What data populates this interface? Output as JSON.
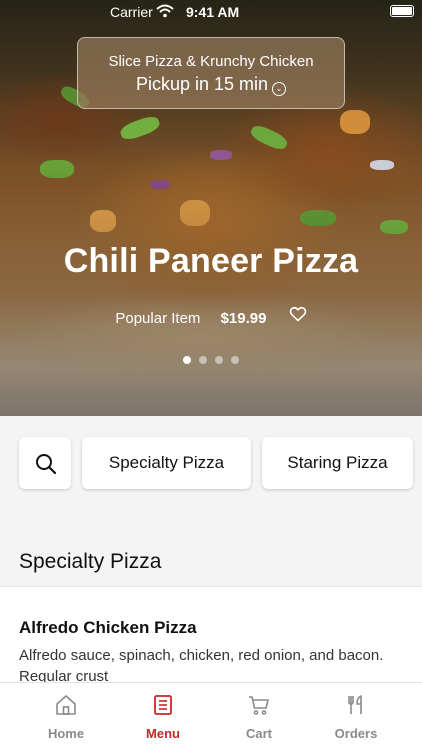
{
  "status_bar": {
    "carrier": "Carrier",
    "time": "9:41 AM"
  },
  "store": {
    "name": "Slice Pizza & Krunchy Chicken",
    "pickup": "Pickup in 15 min"
  },
  "hero": {
    "title": "Chili Paneer Pizza",
    "tag": "Popular Item",
    "price": "$19.99",
    "carousel_pages": 4,
    "carousel_active_page": 1
  },
  "categories": {
    "search_icon": "search-icon",
    "items": [
      {
        "label": "Specialty Pizza"
      },
      {
        "label": "Staring Pizza"
      }
    ]
  },
  "section": {
    "title": "Specialty Pizza"
  },
  "menu_items": [
    {
      "name": "Alfredo Chicken Pizza",
      "description": "Alfredo sauce, spinach, chicken, red onion, and bacon. Regular crust"
    }
  ],
  "tabbar": {
    "items": [
      {
        "label": "Home",
        "icon": "home-icon"
      },
      {
        "label": "Menu",
        "icon": "menu-icon",
        "active": true
      },
      {
        "label": "Cart",
        "icon": "cart-icon"
      },
      {
        "label": "Orders",
        "icon": "fork-knife-icon"
      }
    ]
  },
  "colors": {
    "accent": "#c62828",
    "inactive": "#8a8a8a"
  }
}
